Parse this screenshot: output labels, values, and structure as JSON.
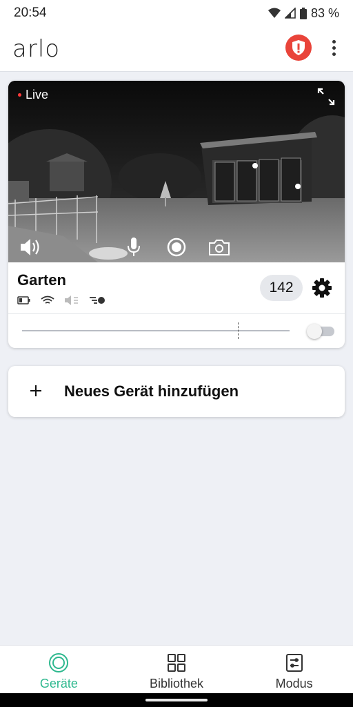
{
  "status_bar": {
    "time": "20:54",
    "battery": "83 %"
  },
  "app_bar": {
    "logo": "arlo",
    "icons": [
      "alert-shield-icon",
      "more-vert-icon"
    ],
    "alert_color": "#e9443a"
  },
  "camera": {
    "live_label": "Live",
    "name": "Garten",
    "clip_count": "142",
    "feed_controls": [
      "speaker-icon",
      "microphone-icon",
      "record-icon",
      "camera-icon"
    ],
    "status_icons": [
      "battery-icon",
      "wifi-icon",
      "speaker-muted-icon",
      "motion-icon"
    ],
    "toggle_on": false
  },
  "add_device": {
    "label": "Neues Gerät hinzufügen"
  },
  "bottom_nav": {
    "accent": "#2db88e",
    "items": [
      {
        "label": "Geräte",
        "icon": "devices-icon",
        "active": true
      },
      {
        "label": "Bibliothek",
        "icon": "grid-icon",
        "active": false
      },
      {
        "label": "Modus",
        "icon": "mode-icon",
        "active": false
      }
    ]
  }
}
